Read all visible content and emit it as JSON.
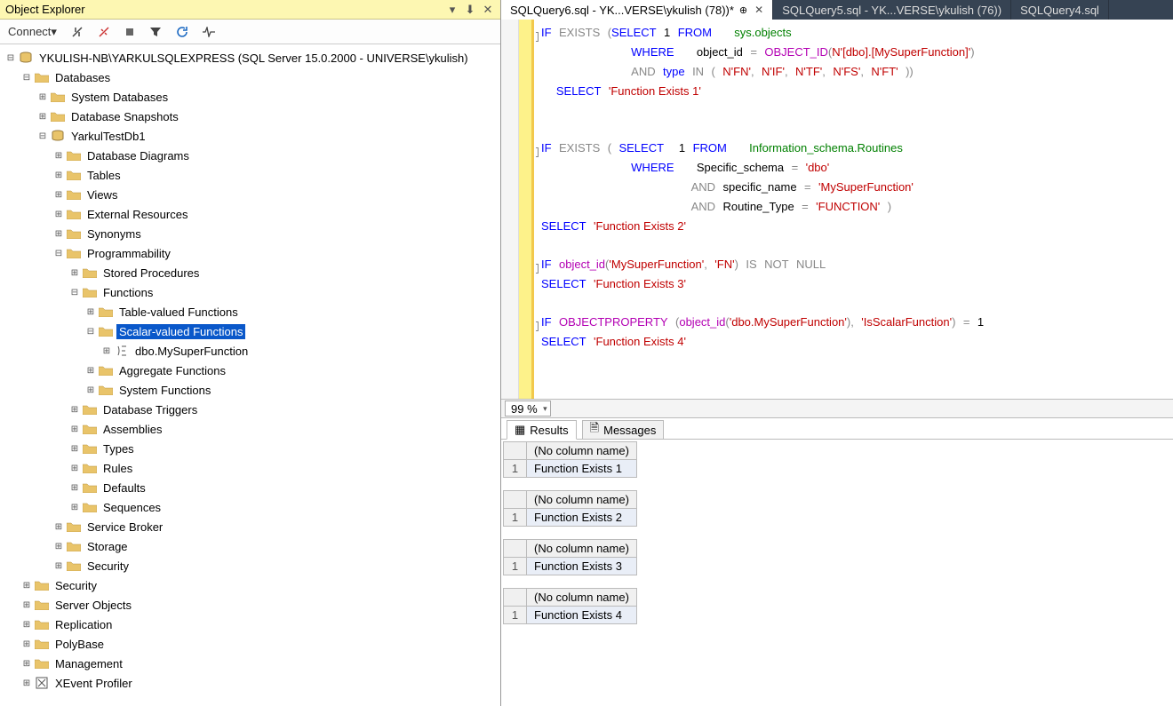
{
  "objectExplorer": {
    "title": "Object Explorer",
    "connect": "Connect",
    "server": "YKULISH-NB\\YARKULSQLEXPRESS (SQL Server 15.0.2000 - UNIVERSE\\ykulish)",
    "nodes": {
      "databases": "Databases",
      "sysdb": "System Databases",
      "dbsnap": "Database Snapshots",
      "testdb": "YarkulTestDb1",
      "diagrams": "Database Diagrams",
      "tables": "Tables",
      "views": "Views",
      "extres": "External Resources",
      "synonyms": "Synonyms",
      "prog": "Programmability",
      "sp": "Stored Procedures",
      "func": "Functions",
      "tvf": "Table-valued Functions",
      "svf": "Scalar-valued Functions",
      "myfunc": "dbo.MySuperFunction",
      "aggf": "Aggregate Functions",
      "sysf": "System Functions",
      "dbtrig": "Database Triggers",
      "asm": "Assemblies",
      "types": "Types",
      "rules": "Rules",
      "defaults": "Defaults",
      "seq": "Sequences",
      "sbroker": "Service Broker",
      "storage": "Storage",
      "security": "Security",
      "rootsec": "Security",
      "srvobj": "Server Objects",
      "repl": "Replication",
      "poly": "PolyBase",
      "mgmt": "Management",
      "xevent": "XEvent Profiler"
    }
  },
  "tabs": [
    "SQLQuery6.sql - YK...VERSE\\ykulish (78))*",
    "SQLQuery5.sql - YK...VERSE\\ykulish (76))",
    "SQLQuery4.sql"
  ],
  "zoom": "99 %",
  "resTabs": {
    "results": "Results",
    "messages": "Messages"
  },
  "results": {
    "header": "(No column name)",
    "r1": "Function Exists 1",
    "r2": "Function Exists 2",
    "r3": "Function Exists 3",
    "r4": "Function Exists 4"
  },
  "sql": {
    "if": "IF",
    "exists": "EXISTS",
    "select": "SELECT",
    "from": "FROM",
    "where": "WHERE",
    "and": "AND",
    "in": "IN",
    "not": "NOT",
    "null": "NULL",
    "is": "IS",
    "one": "1",
    "type": "type",
    "sysobj": "sys.objects",
    "objid": "object_id",
    "objidf": "OBJECT_ID",
    "objprop": "OBJECTPROPERTY",
    "isr": "Information_schema.Routines",
    "specsch": "Specific_schema",
    "specname": "specific_name",
    "rtype": "Routine_Type",
    "eq": "=",
    "comma": ",",
    "op": "(",
    "cp": ")",
    "n": "N",
    "sq": "'",
    "dboMsf": "[dbo].[MySuperFunction]",
    "fn": "FN",
    "nif": "IF",
    "tf": "TF",
    "fs": "FS",
    "ft": "FT",
    "fe1": "'Function Exists 1'",
    "fe2": "'Function Exists 2'",
    "fe3": "'Function Exists 3'",
    "fe4": "'Function Exists 4'",
    "dbo": "'dbo'",
    "msf": "'MySuperFunction'",
    "function": "'FUNCTION'",
    "msf2": "'MySuperFunction'",
    "fn2": "'FN'",
    "dbomsf": "'dbo.MySuperFunction'",
    "isscalar": "'IsScalarFunction'"
  }
}
